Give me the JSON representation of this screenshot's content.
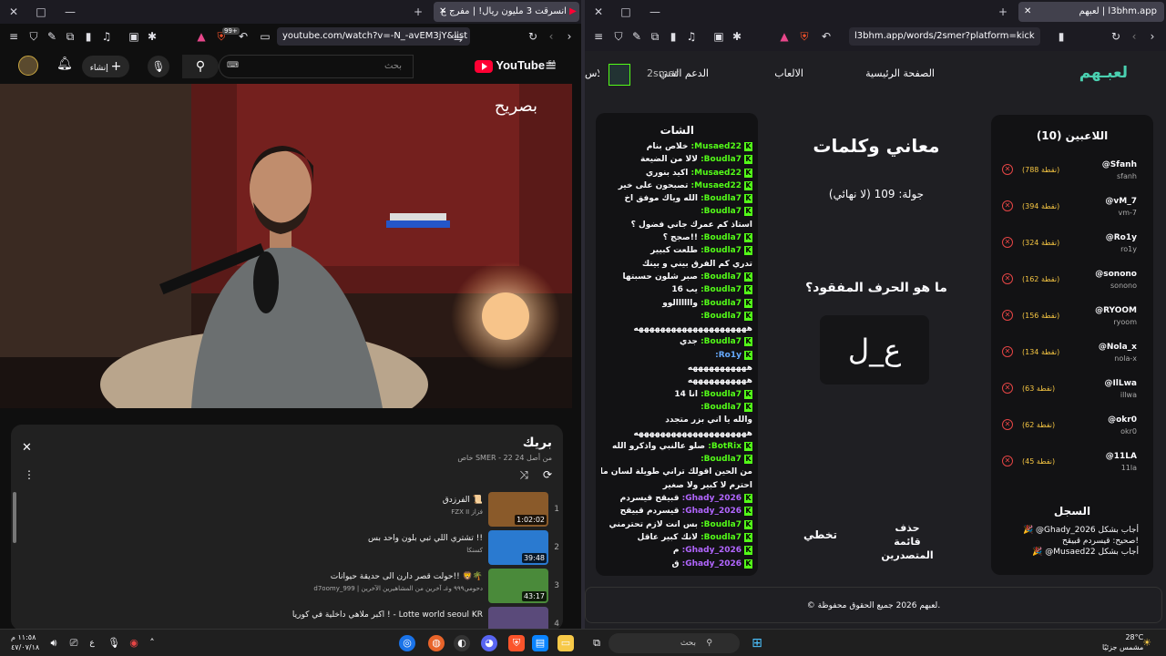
{
  "left_browser": {
    "tab_title": "انسرقت 3 مليون ريال! | مفرج ع",
    "url": "youtube.com/watch?v=-N_-avEM3jY&list",
    "badge_count": "99+"
  },
  "youtube": {
    "logo_text": "YouTube",
    "region": "SA",
    "search_placeholder": "بحث",
    "create_label": "إنشاء",
    "channel_watermark": "بصريح",
    "playlist": {
      "title": "بريك",
      "subtitle": "خاص SMER - 22 من أصل 24",
      "items": [
        {
          "num": "1",
          "title": "الفرزدق 📜",
          "channel": "FZX II فزاز",
          "duration": "1:02:02"
        },
        {
          "num": "2",
          "title": "تشتري اللي تبي بلون واحد بس !!",
          "channel": "كسنكا",
          "duration": "39:48"
        },
        {
          "num": "3",
          "title": "حولت قصر دارن الى حديقة حيوانات!! 🦁🌴",
          "channel": "d7oomy_999 | دحومي٩٩٩ وغـ آخرين من المشاهيرين الآخرين",
          "duration": "43:17"
        },
        {
          "num": "4",
          "title": "اكبر ملاهي داخلية في كوريا ! - Lotte world seoul KR",
          "channel": "",
          "duration": ""
        }
      ]
    }
  },
  "right_browser": {
    "tab_title": "لعبهم | l3bhm.app",
    "url": "l3bhm.app/words/2smer?platform=kick"
  },
  "site": {
    "logo": "لعبـهم",
    "nav": [
      "الصفحة الرئيسية",
      "الالعاب",
      "الدعم الفني",
      "الاس"
    ],
    "user": "2smer",
    "players_title": "اللاعبين (10)",
    "players": [
      {
        "name": "@Sfanh",
        "sub": "sfanh",
        "pts": "(788 نقطة)"
      },
      {
        "name": "@vM_7",
        "sub": "vm-7",
        "pts": "(394 نقطة)"
      },
      {
        "name": "@Ro1y",
        "sub": "ro1y",
        "pts": "(324 نقطة)"
      },
      {
        "name": "@sonono",
        "sub": "sonono",
        "pts": "(162 نقطة)"
      },
      {
        "name": "@RYOOM",
        "sub": "ryoom",
        "pts": "(156 نقطة)"
      },
      {
        "name": "@Nola_x",
        "sub": "nola-x",
        "pts": "(134 نقطة)"
      },
      {
        "name": "@IlLwa",
        "sub": "illwa",
        "pts": "(63 نقطة)"
      },
      {
        "name": "@okr0",
        "sub": "okr0",
        "pts": "(62 نقطة)"
      },
      {
        "name": "@11LA",
        "sub": "11la",
        "pts": "(45 نقطة)"
      }
    ],
    "log_title": "السجل",
    "log": [
      "🎉 @Ghady_2026 أجاب بشكل",
      "صحيح: قيسردم قبيقح!",
      "🎉 @Musaed22 أجاب بشكل"
    ],
    "game_title": "معاني وكلمات",
    "round": "جولة: 109 (لا نهائي)",
    "question": "ما هو الحرف المفقود؟",
    "puzzle": "ع_ل",
    "btn_skip": "تخطي",
    "btn_clear": "حذف قائمة المتصدرين",
    "chat_title": "الشات",
    "footer": "© لعبهم 2026 جميع الحقوق محفوظة.",
    "chat": [
      {
        "u": "Musaed22:",
        "c": "u",
        "m": "خلاص بنام"
      },
      {
        "u": "Boudla7:",
        "c": "u",
        "m": "لالا من الضيعة"
      },
      {
        "u": "Musaed22:",
        "c": "u",
        "m": "اكيد بنوري"
      },
      {
        "u": "Musaed22:",
        "c": "u",
        "m": "تصبحون على خير"
      },
      {
        "u": "Boudla7:",
        "c": "u",
        "m": "الله وياك موفق اخ"
      },
      {
        "u": "Boudla7:",
        "c": "u",
        "m": ""
      },
      {
        "u": "",
        "c": "",
        "m": "استاذ كم عمرك جاني فضول ؟"
      },
      {
        "u": "Boudla7:",
        "c": "u",
        "m": "!!صجج ؟"
      },
      {
        "u": "Boudla7:",
        "c": "u",
        "m": "طلعت كبيير"
      },
      {
        "u": "",
        "c": "",
        "m": "تدري كم الفرق بيني و بينك"
      },
      {
        "u": "Boudla7:",
        "c": "u",
        "m": "صبر شلون حسبتها"
      },
      {
        "u": "Boudla7:",
        "c": "u",
        "m": "يب 16"
      },
      {
        "u": "Boudla7:",
        "c": "u",
        "m": "واااااالوو"
      },
      {
        "u": "Boudla7:",
        "c": "u",
        "m": ""
      },
      {
        "u": "",
        "c": "",
        "m": "هههههههههههههههههههههه"
      },
      {
        "u": "Boudla7:",
        "c": "u",
        "m": "جدي"
      },
      {
        "u": "Ro1y:",
        "c": "u3",
        "m": ""
      },
      {
        "u": "",
        "c": "",
        "m": "هههههههههههه"
      },
      {
        "u": "",
        "c": "",
        "m": "هههههههههههه"
      },
      {
        "u": "Boudla7:",
        "c": "u",
        "m": "انا 14"
      },
      {
        "u": "Boudla7:",
        "c": "u",
        "m": ""
      },
      {
        "u": "",
        "c": "",
        "m": "والله يا اني بزر متجدد"
      },
      {
        "u": "",
        "c": "",
        "m": "هههههههههههههههههههههه"
      },
      {
        "u": "BotRix:",
        "c": "u",
        "m": "صلو عالنبي واذكرو الله"
      },
      {
        "u": "Boudla7:",
        "c": "u",
        "m": ""
      },
      {
        "u": "",
        "c": "",
        "m": "من الحين اقولك تراني طويلة لسان ما"
      },
      {
        "u": "",
        "c": "",
        "m": "احترم لا كبير ولا صغير"
      },
      {
        "u": "Ghady_2026:",
        "c": "u2",
        "m": "قبيقح قيسردم"
      },
      {
        "u": "Ghady_2026:",
        "c": "u2",
        "m": "قيسردم قبيقح"
      },
      {
        "u": "Boudla7:",
        "c": "u",
        "m": "بس انت لازم تحترمني"
      },
      {
        "u": "Boudla7:",
        "c": "u",
        "m": "لانك كبير عاقل"
      },
      {
        "u": "Ghady_2026:",
        "c": "u2",
        "m": "م"
      },
      {
        "u": "Ghady_2026:",
        "c": "u2",
        "m": "ق"
      }
    ]
  },
  "taskbar": {
    "search": "بحث",
    "weather_temp": "28°C",
    "weather_text": "مشمس جزئيًا",
    "time": "١١:٥٨ م",
    "date": "٤٧/٠٧/١٨",
    "lang": "ع"
  },
  "colors": {
    "kick_green": "#53fc18",
    "yt_red": "#ff0033",
    "accent_purple": "#b266ff"
  }
}
